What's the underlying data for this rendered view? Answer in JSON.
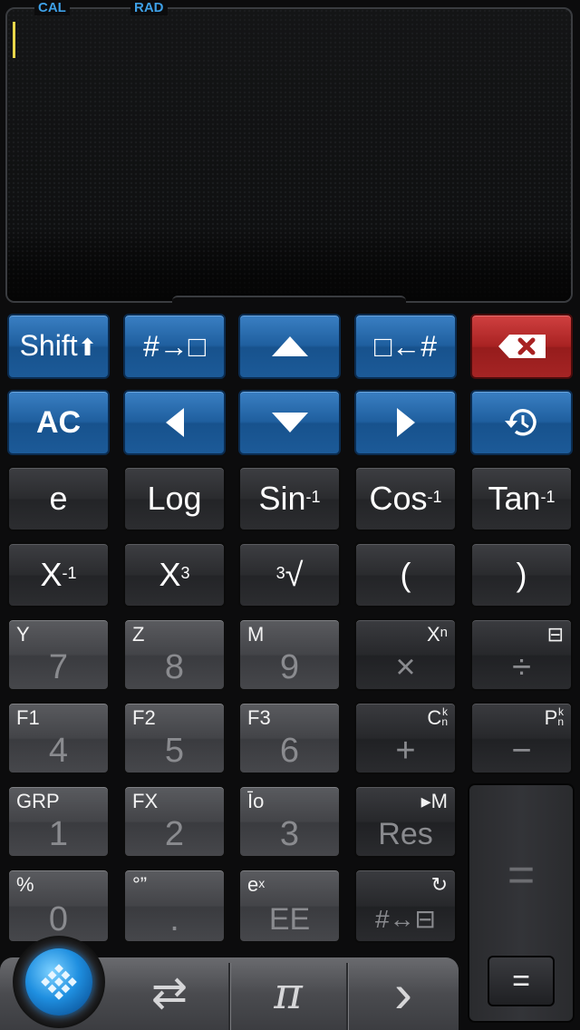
{
  "display": {
    "mode_tag": "CAL",
    "angle_tag": "RAD"
  },
  "nav_row1": {
    "shift": "Shift",
    "shift_arrow": "⬆",
    "to_box": "#→□",
    "box_from": "□←#"
  },
  "nav_row2": {
    "ac": "AC"
  },
  "func_row1": {
    "e": "e",
    "log": "Log",
    "sin": "Sin",
    "sin_sup": "-1",
    "cos": "Cos",
    "cos_sup": "-1",
    "tan": "Tan",
    "tan_sup": "-1"
  },
  "func_row2": {
    "xinv": "X",
    "xinv_sup": "-1",
    "xcube": "X",
    "xcube_sup": "3",
    "cbrt_index": "3",
    "cbrt": "√",
    "lparen": "(",
    "rparen": ")"
  },
  "keypad": {
    "k7": {
      "main": "7",
      "sub": "Y"
    },
    "k8": {
      "main": "8",
      "sub": "Z"
    },
    "k9": {
      "main": "9",
      "sub": "M"
    },
    "mul": {
      "main": "×",
      "sub": "X",
      "sub_sup": "n"
    },
    "div": {
      "main": "÷",
      "sub": "⊟"
    },
    "k4": {
      "main": "4",
      "sub": "F1"
    },
    "k5": {
      "main": "5",
      "sub": "F2"
    },
    "k6": {
      "main": "6",
      "sub": "F3"
    },
    "plus": {
      "main": "+",
      "sub": "C",
      "sub_sup": "k",
      "sub_subscript": "n"
    },
    "minus": {
      "main": "−",
      "sub": "P",
      "sub_sup": "k",
      "sub_subscript": "n"
    },
    "k1": {
      "main": "1",
      "sub": "GRP"
    },
    "k2": {
      "main": "2",
      "sub": "FX"
    },
    "k3": {
      "main": "3",
      "sub": "Īo"
    },
    "res": {
      "main": "Res",
      "sub": "▸M"
    },
    "k0": {
      "main": "0",
      "sub": "%"
    },
    "dot": {
      "main": ".",
      "sub": "°”"
    },
    "ee": {
      "main": "EE",
      "sub": "e",
      "sub_sup": "x"
    },
    "conv": {
      "main": "#↔⊟",
      "sub": "↻"
    }
  },
  "equals": {
    "big": "=",
    "small": "="
  },
  "tabbar": {
    "convert": "⇄",
    "pi": "π",
    "next": "›"
  }
}
